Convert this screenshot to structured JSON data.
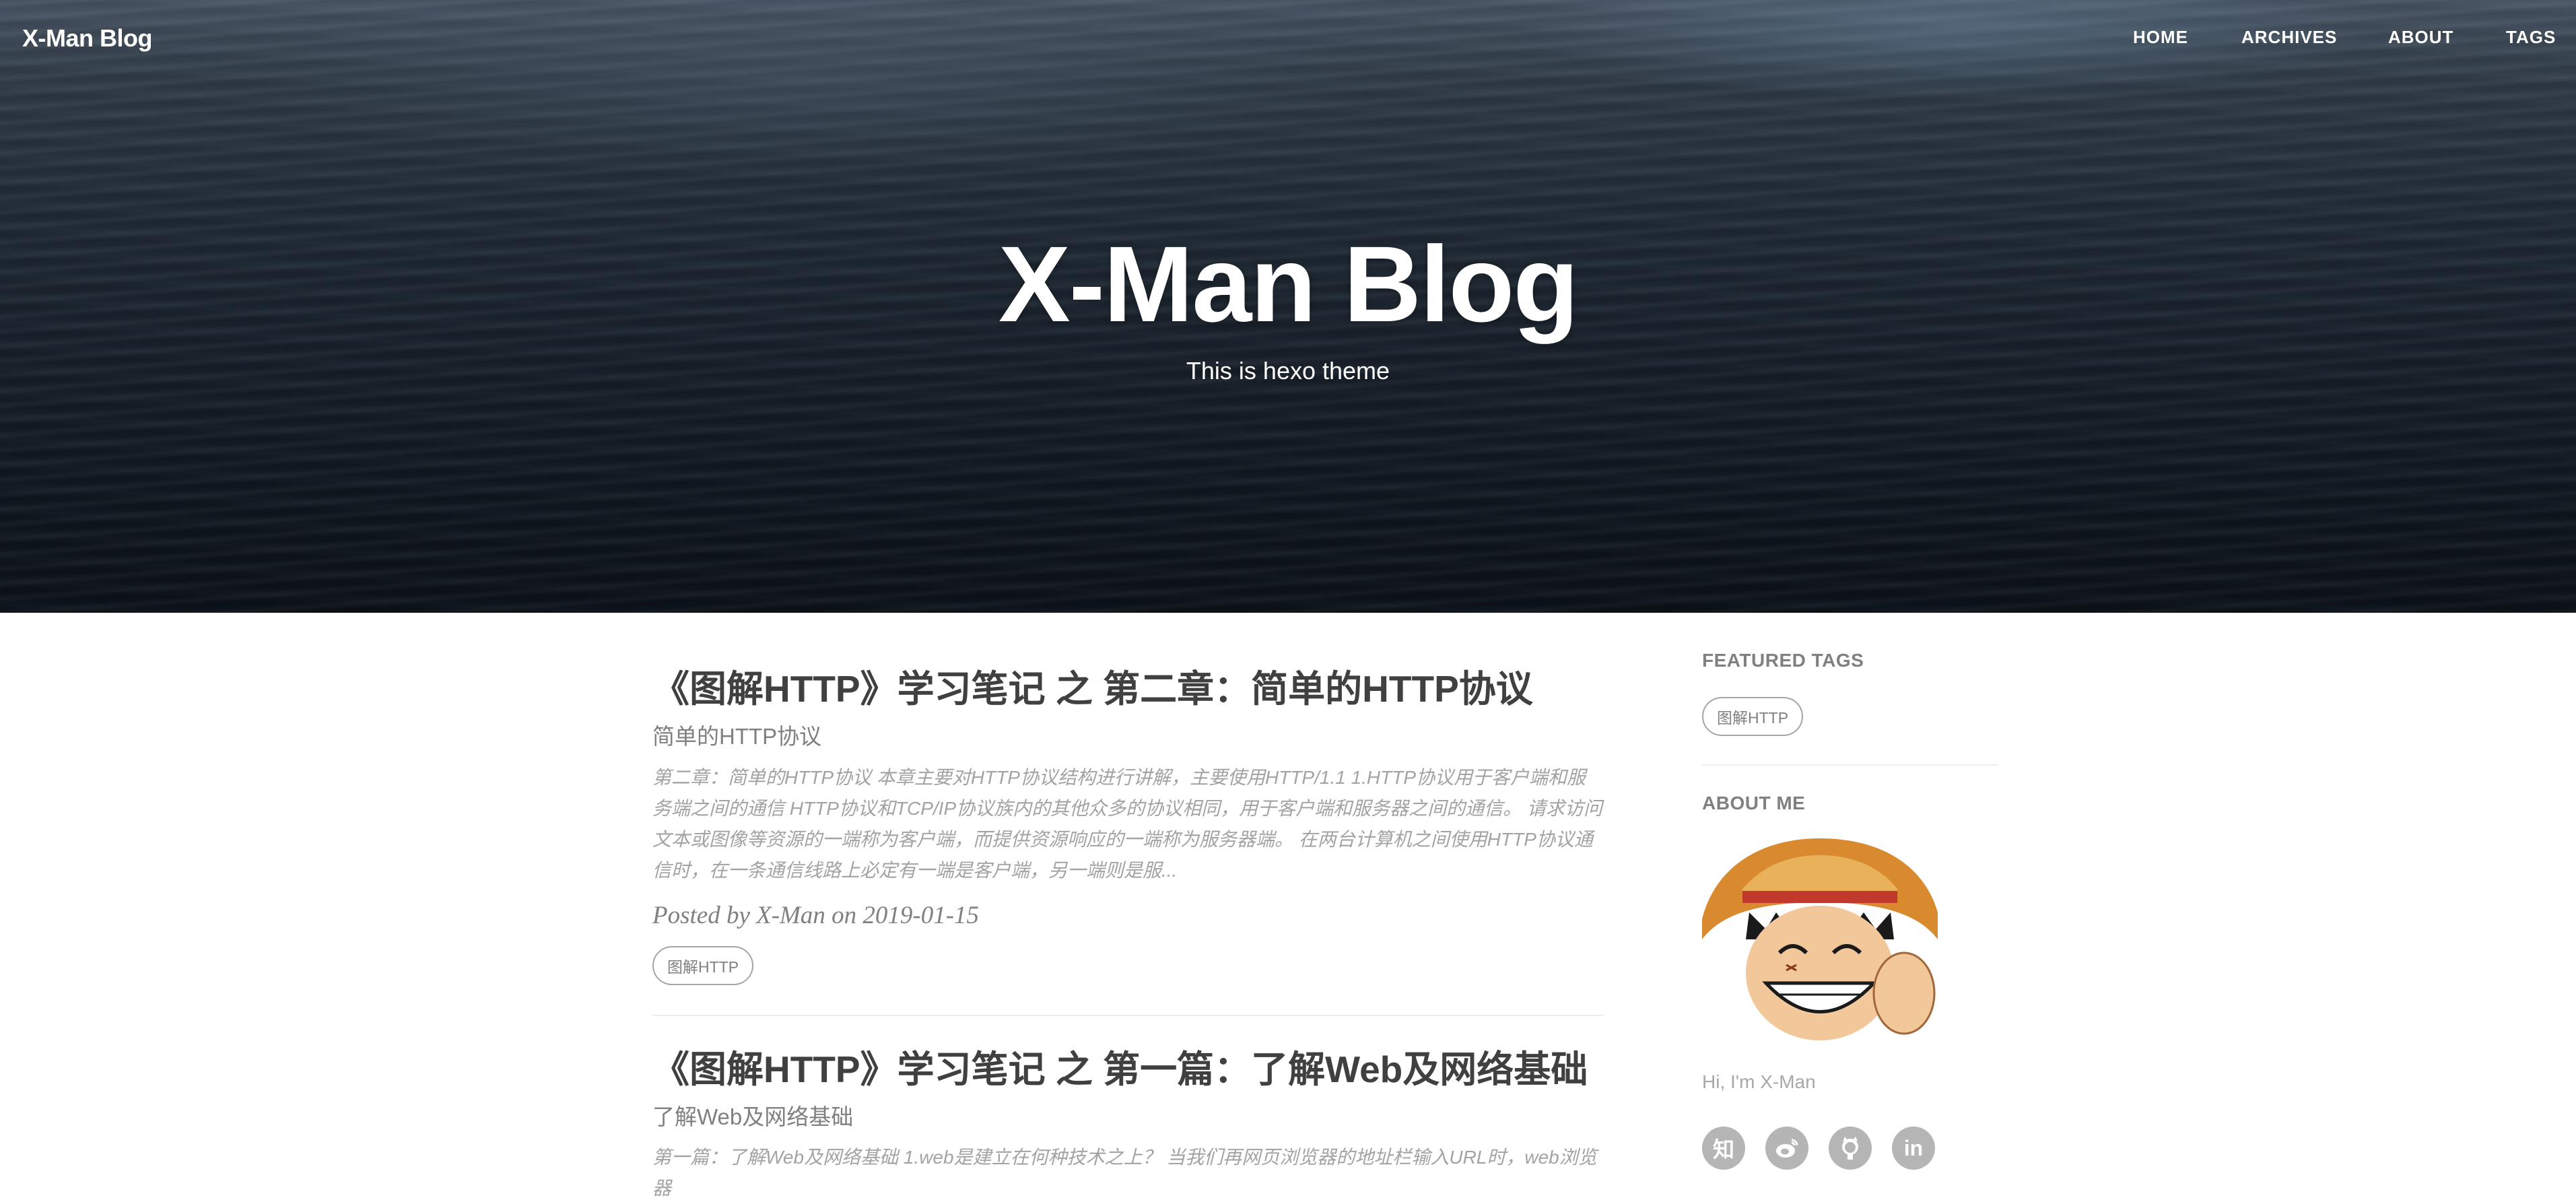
{
  "nav": {
    "brand": "X-Man Blog",
    "links": [
      {
        "label": "HOME"
      },
      {
        "label": "ARCHIVES"
      },
      {
        "label": "ABOUT"
      },
      {
        "label": "TAGS"
      }
    ]
  },
  "hero": {
    "title": "X-Man Blog",
    "subtitle": "This is hexo theme"
  },
  "posts": [
    {
      "title": "《图解HTTP》学习笔记 之 第二章：简单的HTTP协议",
      "subtitle": "简单的HTTP协议",
      "excerpt": "第二章：简单的HTTP协议 本章主要对HTTP协议结构进行讲解，主要使用HTTP/1.1 1.HTTP协议用于客户端和服务端之间的通信 HTTP协议和TCP/IP协议族内的其他众多的协议相同，用于客户端和服务器之间的通信。 请求访问文本或图像等资源的一端称为客户端，而提供资源响应的一端称为服务器端。 在两台计算机之间使用HTTP协议通信时，在一条通信线路上必定有一端是客户端，另一端则是服...",
      "meta": "Posted by X-Man on 2019-01-15",
      "tag": "图解HTTP"
    },
    {
      "title": "《图解HTTP》学习笔记 之 第一篇：了解Web及网络基础",
      "subtitle": "了解Web及网络基础",
      "excerpt": "第一篇：了解Web及网络基础 1.web是建立在何种技术之上？ 当我们再网页浏览器的地址栏输入URL时，web浏览器"
    }
  ],
  "sidebar": {
    "featured_heading": "FEATURED TAGS",
    "featured_tags": [
      "图解HTTP"
    ],
    "about_heading": "ABOUT ME",
    "hello": "Hi, I'm X-Man",
    "social": [
      {
        "icon": "zhihu-icon",
        "glyph": "知"
      },
      {
        "icon": "weibo-icon",
        "glyph": ""
      },
      {
        "icon": "github-icon",
        "glyph": ""
      },
      {
        "icon": "linkedin-icon",
        "glyph": "in"
      }
    ]
  },
  "colors": {
    "text": "#404040",
    "muted": "#808080",
    "light": "#a3a3a3",
    "social_bg": "#b5b5b5"
  }
}
